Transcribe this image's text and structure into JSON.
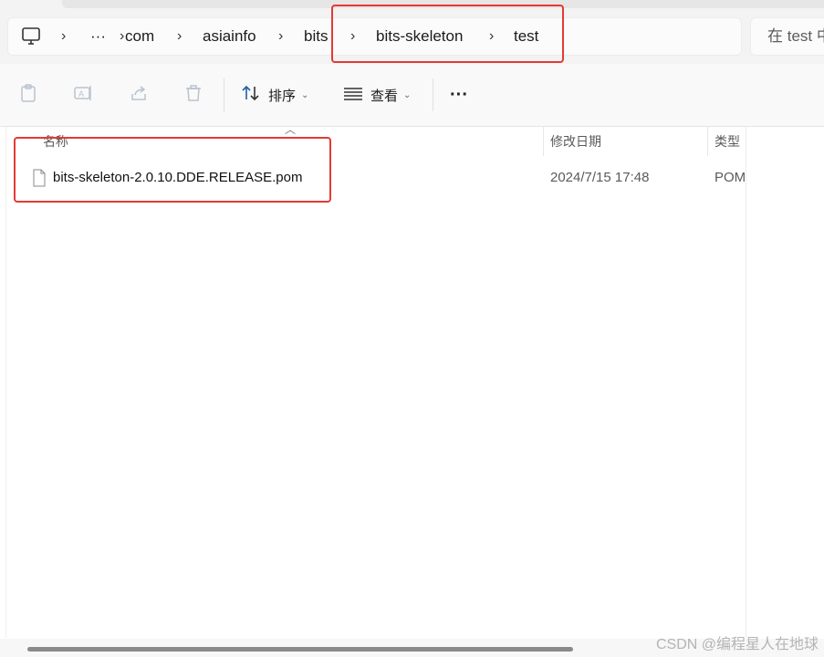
{
  "breadcrumb": {
    "more": "···",
    "items": [
      "com",
      "asiainfo",
      "bits",
      "bits-skeleton",
      "test"
    ]
  },
  "search": {
    "placeholder": "在 test 中"
  },
  "toolbar": {
    "sort_label": "排序",
    "view_label": "查看",
    "more_label": "···"
  },
  "columns": {
    "name": "名称",
    "modified": "修改日期",
    "type": "类型"
  },
  "files": [
    {
      "name": "bits-skeleton-2.0.10.DDE.RELEASE.pom",
      "modified": "2024/7/15 17:48",
      "type": "POM"
    }
  ],
  "watermark": "CSDN @编程星人在地球",
  "colors": {
    "highlight": "#e53935",
    "accent": "#0067c0"
  }
}
